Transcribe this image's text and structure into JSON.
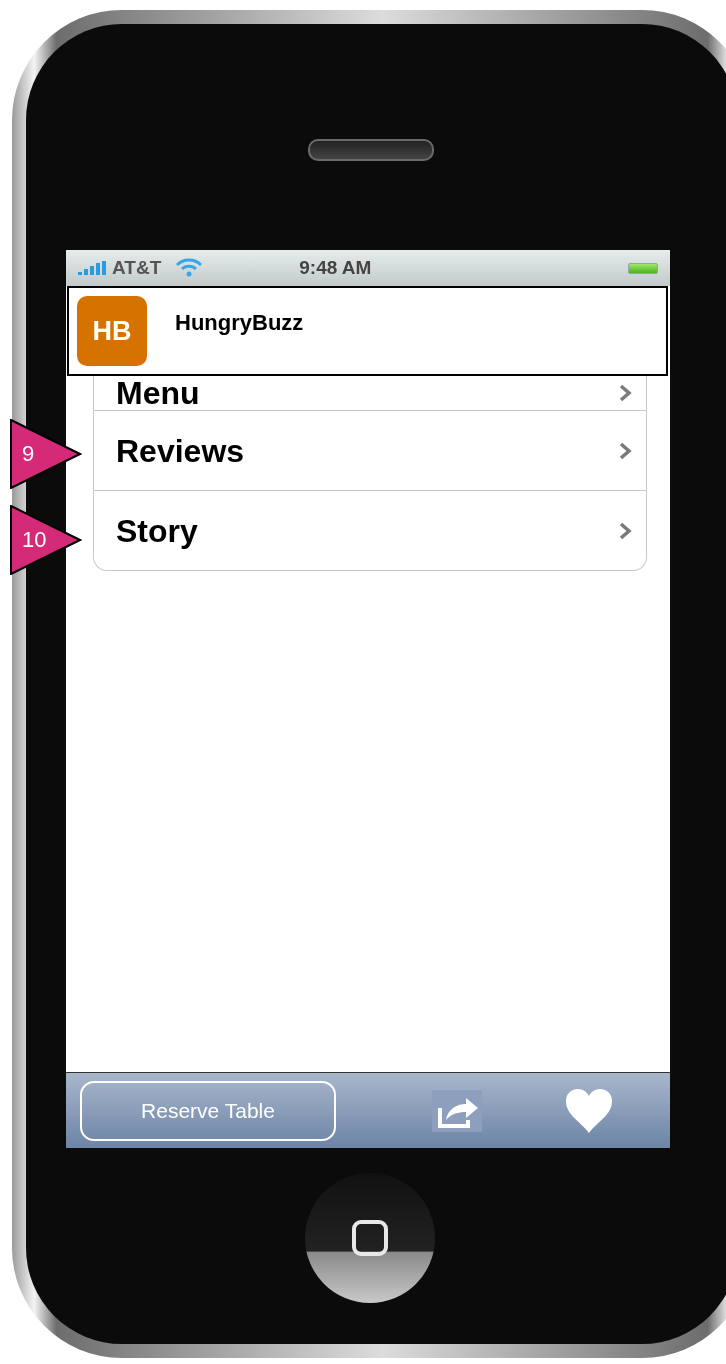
{
  "status_bar": {
    "carrier": "AT&T",
    "time": "9:48 AM"
  },
  "header": {
    "logo": "HB",
    "title": "HungryBuzz"
  },
  "menu_items": [
    {
      "label": "Menu"
    },
    {
      "label": "Reviews"
    },
    {
      "label": "Story"
    }
  ],
  "toolbar": {
    "button": "Reserve Table"
  },
  "annotations": [
    {
      "label": "9"
    },
    {
      "label": "10"
    }
  ]
}
